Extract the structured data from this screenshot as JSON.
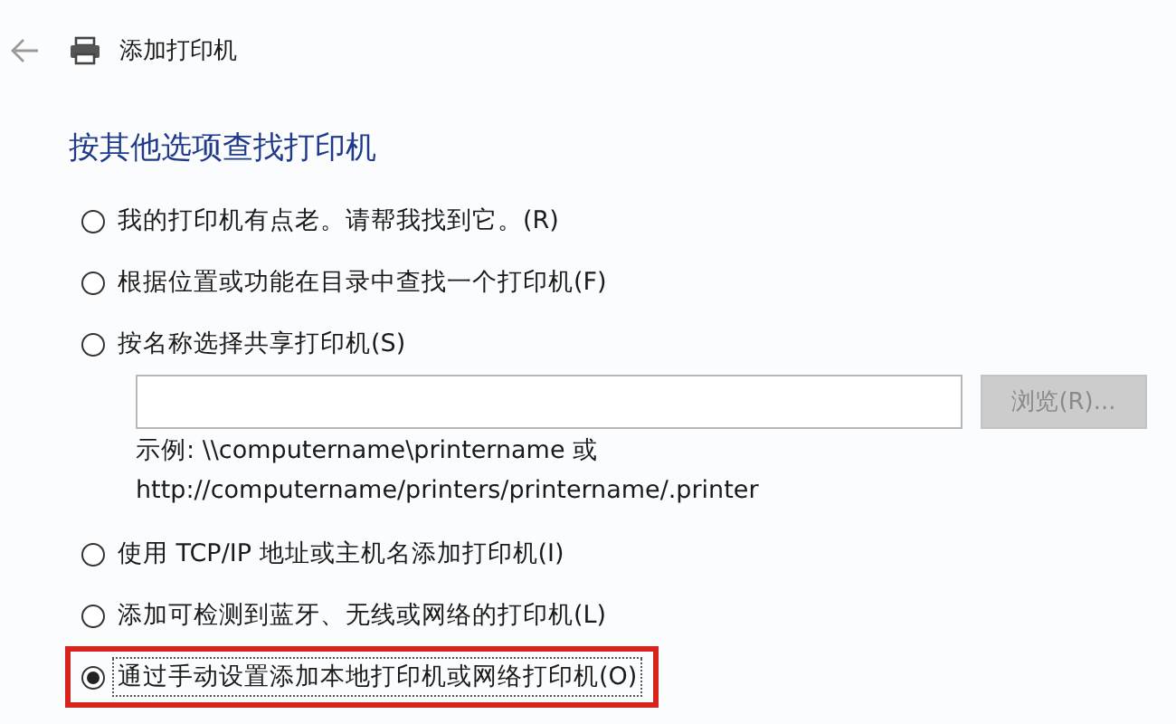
{
  "header": {
    "title": "添加打印机"
  },
  "heading": "按其他选项查找打印机",
  "options": [
    {
      "label": "我的打印机有点老。请帮我找到它。(R)",
      "selected": false,
      "highlighted": false
    },
    {
      "label": "根据位置或功能在目录中查找一个打印机(F)",
      "selected": false,
      "highlighted": false
    },
    {
      "label": "按名称选择共享打印机(S)",
      "selected": false,
      "highlighted": false,
      "share": {
        "value_field": {
          "disabled": false
        },
        "browse_button": {
          "label": "浏览(R)...",
          "disabled": true
        },
        "example_lines": [
          "示例: \\\\computername\\printername 或",
          "http://computername/printers/printername/.printer"
        ]
      }
    },
    {
      "label": "使用 TCP/IP 地址或主机名添加打印机(I)",
      "selected": false,
      "highlighted": false
    },
    {
      "label": "添加可检测到蓝牙、无线或网络的打印机(L)",
      "selected": false,
      "highlighted": false
    },
    {
      "label": "通过手动设置添加本地打印机或网络打印机(O)",
      "selected": true,
      "highlighted": true
    }
  ]
}
